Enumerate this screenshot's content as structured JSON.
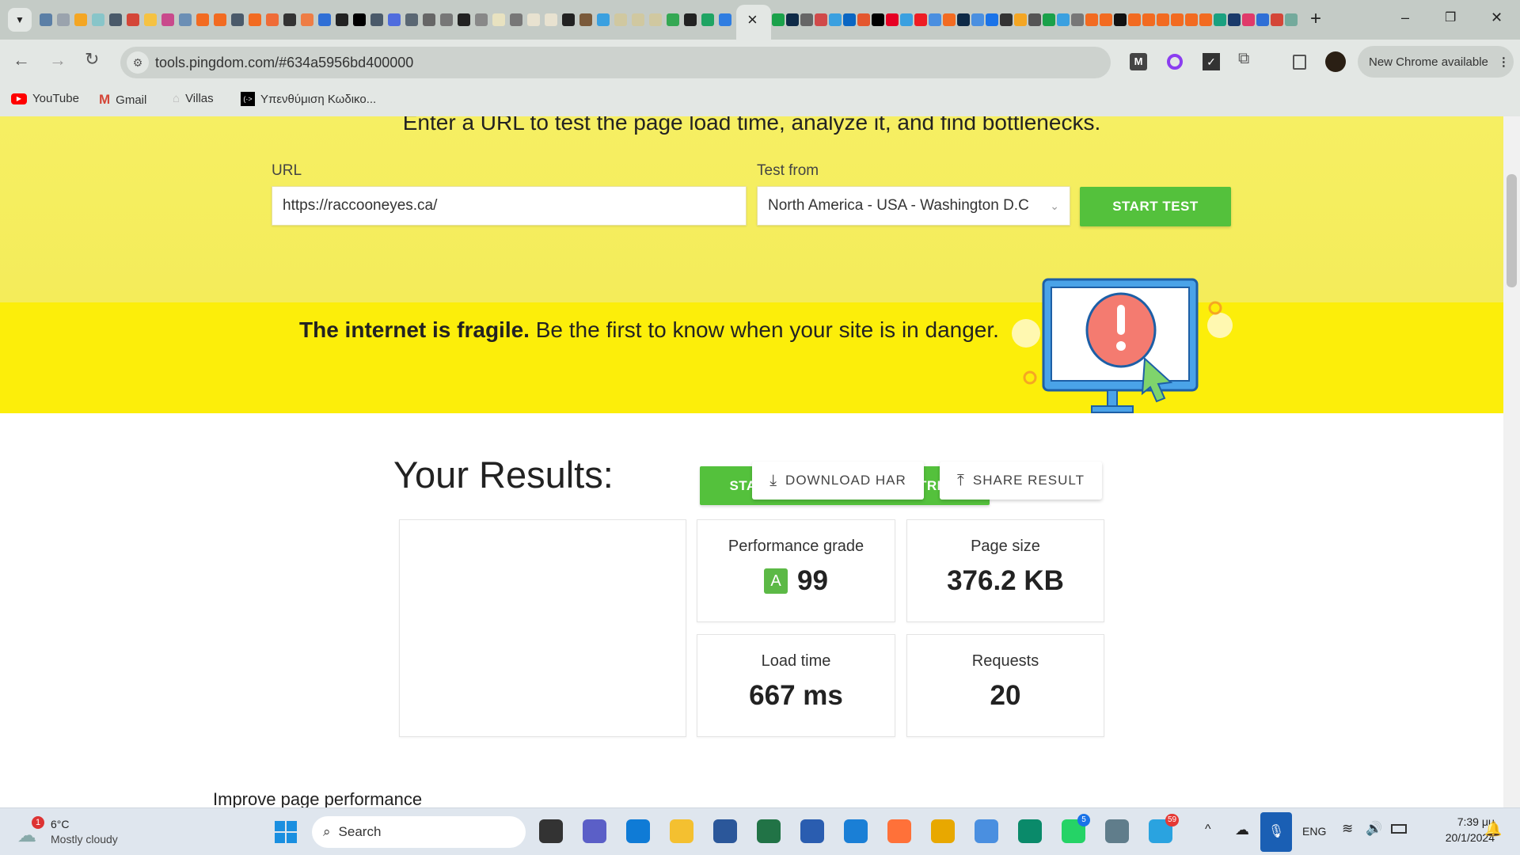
{
  "browser": {
    "favicon_colors": [
      "#5b7fa6",
      "#9aa3ad",
      "#f4a623",
      "#88c5c9",
      "#4a5a6a",
      "#d44638",
      "#f5c242",
      "#c94a8c",
      "#6b8fb5",
      "#f26b21",
      "#f26b21",
      "#4a5a6a",
      "#f26b21",
      "#ef6c37",
      "#333333",
      "#ee7d45",
      "#2f6fd6",
      "#222222",
      "#000000",
      "#4a5a6a",
      "#4f6cde",
      "#5a6773",
      "#666666",
      "#777777",
      "#222222",
      "#888888",
      "#e8e2c0",
      "#777777",
      "#e8e2d0",
      "#e8e2d0",
      "#222222",
      "#7a5a3a",
      "#3aa0e0",
      "#d0c8a0",
      "#d0c8a0",
      "#d0c8a0",
      "#34a853",
      "#222222",
      "#1fa463",
      "#2f7de1"
    ],
    "favicon_colors_right": [
      "#1aa14a",
      "#0e2a47",
      "#666666",
      "#d04a4a",
      "#3aa0e0",
      "#0a66c2",
      "#e4572e",
      "#000000",
      "#e60023",
      "#3aa0e0",
      "#ee1d24",
      "#4a8fe0",
      "#f26b21",
      "#0e2a47",
      "#4a8fe0",
      "#1a73e8",
      "#333333",
      "#f4a623",
      "#555555",
      "#1aa14a",
      "#3aa0e0",
      "#777777",
      "#f26b21",
      "#f26b21",
      "#111111",
      "#f26b21",
      "#f26b21",
      "#f26b21",
      "#f26b21",
      "#f26b21",
      "#f26b21",
      "#1aa180",
      "#1a3a6a",
      "#e03a6a",
      "#2f6fd6",
      "#d44638",
      "#74aa9c"
    ],
    "active_tab_close": "×",
    "new_tab": "+",
    "window_controls": [
      "–",
      "❐",
      "✕"
    ],
    "address": "tools.pingdom.com/#634a5956bd400000",
    "update_label": "New Chrome available",
    "bookmarks": [
      {
        "label": "YouTube",
        "icon": "youtube-icon",
        "color": "#ff0000"
      },
      {
        "label": "Gmail",
        "icon": "gmail-icon",
        "color": "#d44638"
      },
      {
        "label": "Villas",
        "icon": "villas-icon",
        "color": "#bbbbbb"
      },
      {
        "label": "Υπενθύμιση Κωδικο...",
        "icon": "terminal-icon",
        "color": "#000000"
      }
    ]
  },
  "hero": {
    "heading": "Enter a URL to test the page load time, analyze it, and find bottlenecks.",
    "url_label": "URL",
    "url_value": "https://raccooneyes.ca/",
    "test_from_label": "Test from",
    "test_from_value": "North America - USA - Washington D.C",
    "start_test": "START TEST"
  },
  "banner": {
    "bold": "The internet is fragile.",
    "rest": " Be the first to know when your site is in danger.",
    "cta": "START YOUR FREE 14-DAY TRIAL"
  },
  "results": {
    "title": "Your Results:",
    "download_har": "DOWNLOAD HAR",
    "share_result": "SHARE RESULT",
    "cards": [
      {
        "title": "Performance grade",
        "grade": "A",
        "value": "99",
        "grade_color": "#5cb946"
      },
      {
        "title": "Page size",
        "value": "376.2 KB"
      },
      {
        "title": "Load time",
        "value": "667 ms"
      },
      {
        "title": "Requests",
        "value": "20"
      }
    ],
    "improve": "Improve page performance"
  },
  "taskbar": {
    "weather_temp": "6°C",
    "weather_desc": "Mostly cloudy",
    "weather_badge": "1",
    "search": "Search",
    "lang": "ENG",
    "time": "7:39 μμ",
    "date": "20/1/2024",
    "whatsapp_badge": "5",
    "telegram_badge": "59"
  },
  "colors": {
    "accent_green": "#54c13c",
    "banner_yellow": "#fcee0a",
    "hero_yellow": "#f6ef63"
  }
}
